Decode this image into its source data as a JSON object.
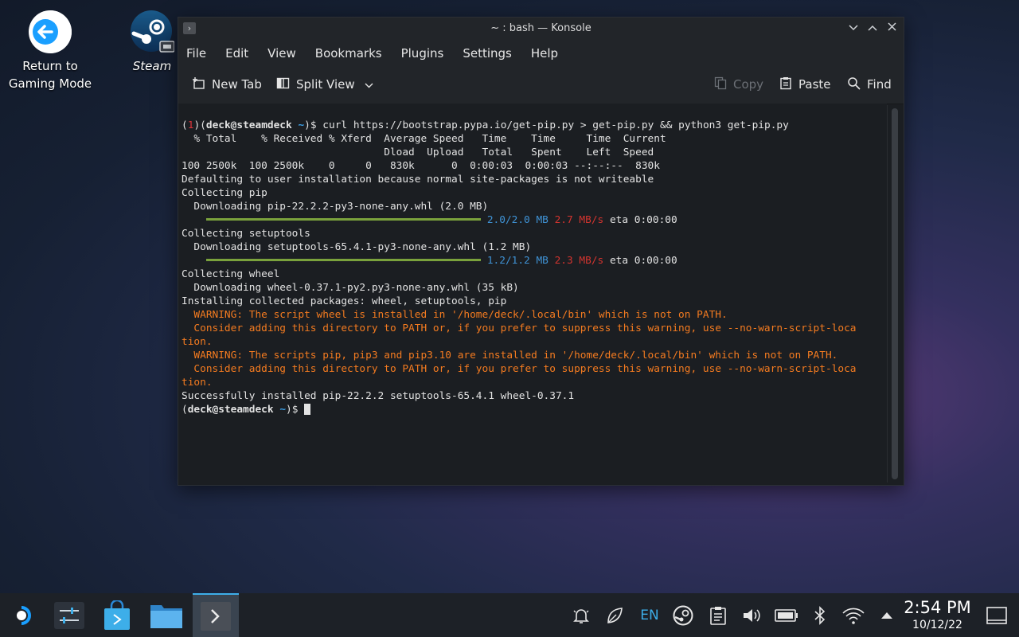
{
  "desktop": {
    "icons": [
      {
        "label_line1": "Return to",
        "label_line2": "Gaming Mode"
      },
      {
        "label": "Steam"
      }
    ]
  },
  "window": {
    "title": "~ : bash — Konsole",
    "menu": [
      "File",
      "Edit",
      "View",
      "Bookmarks",
      "Plugins",
      "Settings",
      "Help"
    ],
    "toolbar": {
      "new_tab": "New Tab",
      "split_view": "Split View",
      "copy": "Copy",
      "paste": "Paste",
      "find": "Find"
    }
  },
  "terminal": {
    "prompt_user": "deck@steamdeck",
    "prompt_path": "~",
    "prompt_exit": "1",
    "command": "curl https://bootstrap.pypa.io/get-pip.py > get-pip.py && python3 get-pip.py",
    "lines": [
      "  % Total    % Received % Xferd  Average Speed   Time    Time     Time  Current",
      "                                 Dload  Upload   Total   Spent    Left  Speed",
      "100 2500k  100 2500k    0     0   830k      0  0:00:03  0:00:03 --:--:--  830k",
      "Defaulting to user installation because normal site-packages is not writeable",
      "Collecting pip",
      "  Downloading pip-22.2.2-py3-none-any.whl (2.0 MB)"
    ],
    "pip_progress": {
      "size": "2.0/2.0 MB",
      "speed": "2.7 MB/s",
      "eta": "eta 0:00:00"
    },
    "lines2": [
      "Collecting setuptools",
      "  Downloading setuptools-65.4.1-py3-none-any.whl (1.2 MB)"
    ],
    "setuptools_progress": {
      "size": "1.2/1.2 MB",
      "speed": "2.3 MB/s",
      "eta": "eta 0:00:00"
    },
    "lines3": [
      "Collecting wheel",
      "  Downloading wheel-0.37.1-py2.py3-none-any.whl (35 kB)",
      "Installing collected packages: wheel, setuptools, pip"
    ],
    "warnings": [
      "  WARNING: The script wheel is installed in '/home/deck/.local/bin' which is not on PATH.",
      "  Consider adding this directory to PATH or, if you prefer to suppress this warning, use --no-warn-script-loca",
      "tion.",
      "  WARNING: The scripts pip, pip3 and pip3.10 are installed in '/home/deck/.local/bin' which is not on PATH.",
      "  Consider adding this directory to PATH or, if you prefer to suppress this warning, use --no-warn-script-loca",
      "tion."
    ],
    "success": "Successfully installed pip-22.2.2 setuptools-65.4.1 wheel-0.37.1"
  },
  "taskbar": {
    "keyboard_layout": "EN",
    "time": "2:54 PM",
    "date": "10/12/22"
  },
  "colors": {
    "accent": "#3daee9",
    "progress": "#7aa23c",
    "warning": "#f47b20",
    "error": "#e0353a"
  }
}
